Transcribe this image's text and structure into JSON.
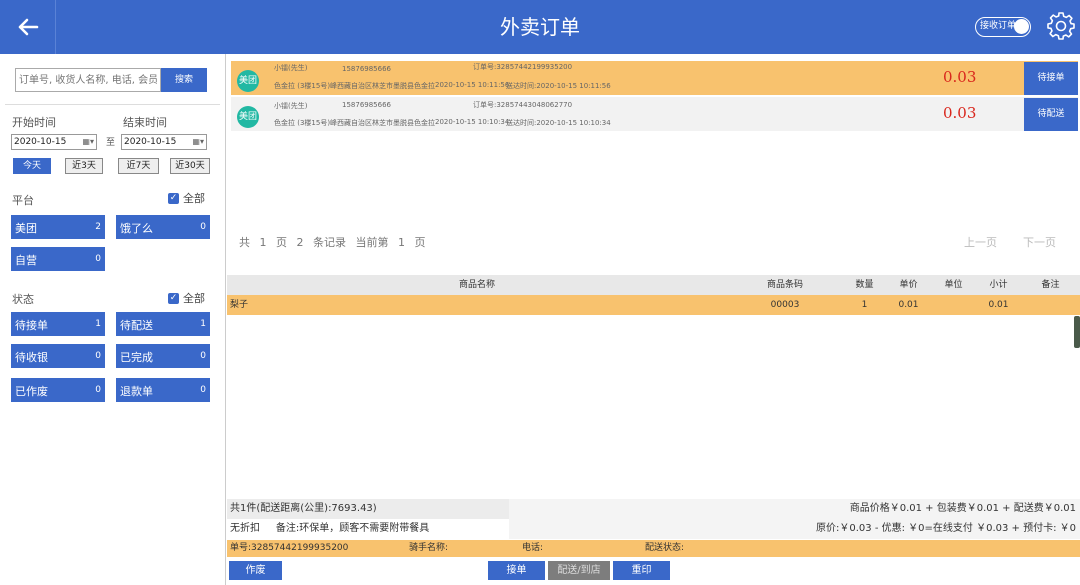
{
  "header": {
    "title": "外卖订单",
    "toggle_label": "接收订单"
  },
  "search": {
    "placeholder": "订单号, 收货人名称, 电话, 会员",
    "button": "搜索"
  },
  "dates": {
    "start_label": "开始时间",
    "end_label": "结束时间",
    "start": "2020-10-15",
    "end": "2020-10-15",
    "to": "至"
  },
  "quick": [
    "今天",
    "近3天",
    "近7天",
    "近30天"
  ],
  "platform": {
    "label": "平台",
    "all": "全部",
    "items": [
      {
        "label": "美团",
        "count": "2"
      },
      {
        "label": "饿了么",
        "count": "0"
      },
      {
        "label": "自营",
        "count": "0"
      }
    ]
  },
  "status": {
    "label": "状态",
    "all": "全部",
    "items": [
      {
        "label": "待接单",
        "count": "1"
      },
      {
        "label": "待配送",
        "count": "1"
      },
      {
        "label": "待收银",
        "count": "0"
      },
      {
        "label": "已完成",
        "count": "0"
      },
      {
        "label": "已作废",
        "count": "0"
      },
      {
        "label": "退款单",
        "count": "0"
      }
    ]
  },
  "orders": [
    {
      "badge": "美团",
      "name": "小镭(先生)",
      "phone": "15876985666",
      "order_no": "订单号:32857442199935200",
      "address": "色金拉 (3楼15号)峰西藏自治区林芝市墨脱县色金拉",
      "order_time": "2020-10-15 10:11:56",
      "delivery": "送达时间:2020-10-15 10:11:56",
      "amount": "0.03",
      "action": "待接单"
    },
    {
      "badge": "美团",
      "name": "小镭(先生)",
      "phone": "15876985666",
      "order_no": "订单号:32857443048062770",
      "address": "色金拉 (3楼15号)峰西藏自治区林芝市墨脱县色金拉",
      "order_time": "2020-10-15 10:10:34",
      "delivery": "送达时间:2020-10-15 10:10:34",
      "amount": "0.03",
      "action": "待配送"
    }
  ],
  "pager": {
    "text": "共 1 页 2 条记录 当前第 1 页",
    "prev": "上一页",
    "next": "下一页"
  },
  "table": {
    "headers": [
      "商品名称",
      "商品条码",
      "数量",
      "单价",
      "单位",
      "小计",
      "备注"
    ],
    "rows": [
      {
        "name": "梨子",
        "code": "00003",
        "qty": "1",
        "price": "0.01",
        "unit": "",
        "subtotal": "0.01",
        "note": ""
      }
    ]
  },
  "summary": {
    "left1": "共1件(配送距离(公里):7693.43)",
    "right1": "商品价格￥0.01 + 包装费￥0.01 + 配送费￥0.01",
    "left2": "无折扣     备注:环保单，顾客不需要附带餐具",
    "right2": "原价:￥0.03 - 优惠: ￥0=在线支付 ￥0.03 + 预付卡: ￥0"
  },
  "footer": {
    "order_no": "单号:32857442199935200",
    "rider": "骑手名称:",
    "phone": "电话:",
    "state": "配送状态:"
  },
  "actions": {
    "void": "作废",
    "accept": "接单",
    "deliver": "配送/到店",
    "reprint": "重印"
  }
}
